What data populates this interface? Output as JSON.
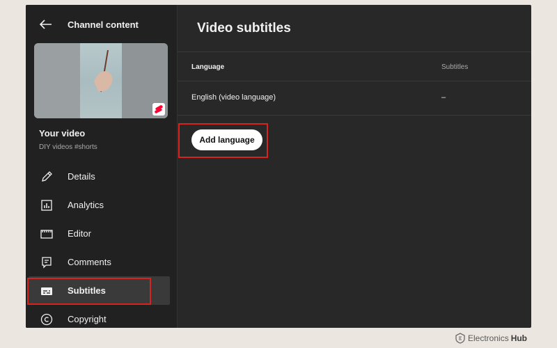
{
  "sidebar": {
    "header_title": "Channel content",
    "video_title": "Your video",
    "video_subtitle": "DIY videos #shorts",
    "items": [
      {
        "label": "Details",
        "icon": "pencil-icon"
      },
      {
        "label": "Analytics",
        "icon": "analytics-icon"
      },
      {
        "label": "Editor",
        "icon": "editor-icon"
      },
      {
        "label": "Comments",
        "icon": "comments-icon"
      },
      {
        "label": "Subtitles",
        "icon": "subtitles-icon",
        "active": true
      },
      {
        "label": "Copyright",
        "icon": "copyright-icon"
      }
    ]
  },
  "main": {
    "title": "Video subtitles",
    "table": {
      "headers": [
        "Language",
        "Subtitles"
      ],
      "rows": [
        [
          "English (video language)",
          "–"
        ]
      ]
    },
    "add_language_label": "Add language"
  },
  "watermark": {
    "brand": "Electronics",
    "brand_bold": "Hub"
  },
  "colors": {
    "highlight": "#d9231e",
    "app_bg": "#282828",
    "sidebar_bg": "#212121",
    "shorts_red": "#ff0033"
  }
}
